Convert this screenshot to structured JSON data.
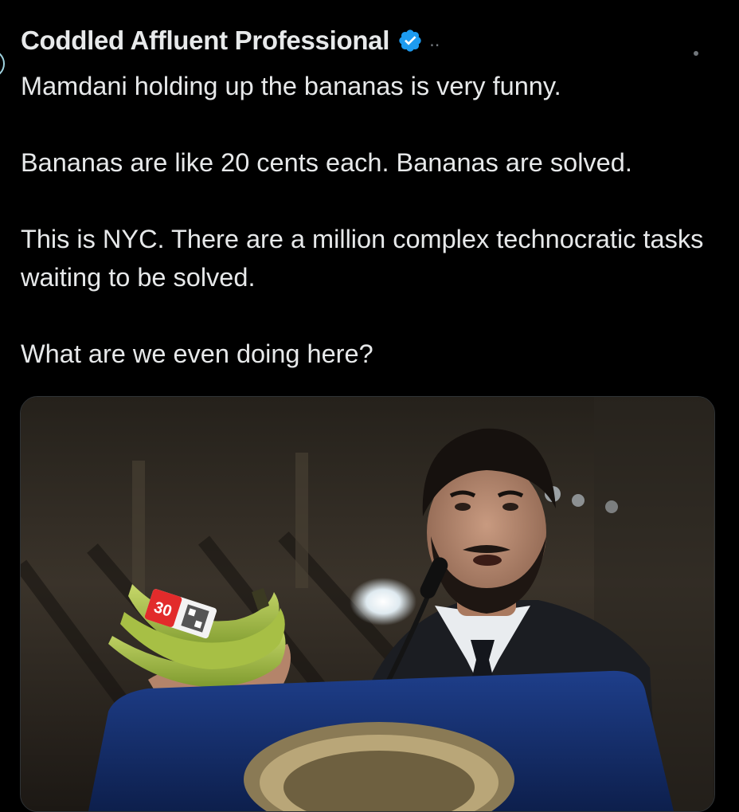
{
  "tweet": {
    "author_name": "Coddled Affluent Professional",
    "handle_truncated": "..",
    "verified": true,
    "paragraphs": [
      "Mamdani holding up the bananas is very funny.",
      "Bananas are like 20 cents each. Bananas are solved.",
      "This is NYC. There are a million complex technocratic tasks waiting to be solved.",
      "What are we even doing here?"
    ]
  },
  "media": {
    "banana_price_sticker": "30",
    "icon": "photo-man-holding-bananas-at-podium"
  },
  "colors": {
    "background": "#000000",
    "text": "#e7e9ea",
    "secondary": "#71767b",
    "verified": "#1d9bf0"
  }
}
